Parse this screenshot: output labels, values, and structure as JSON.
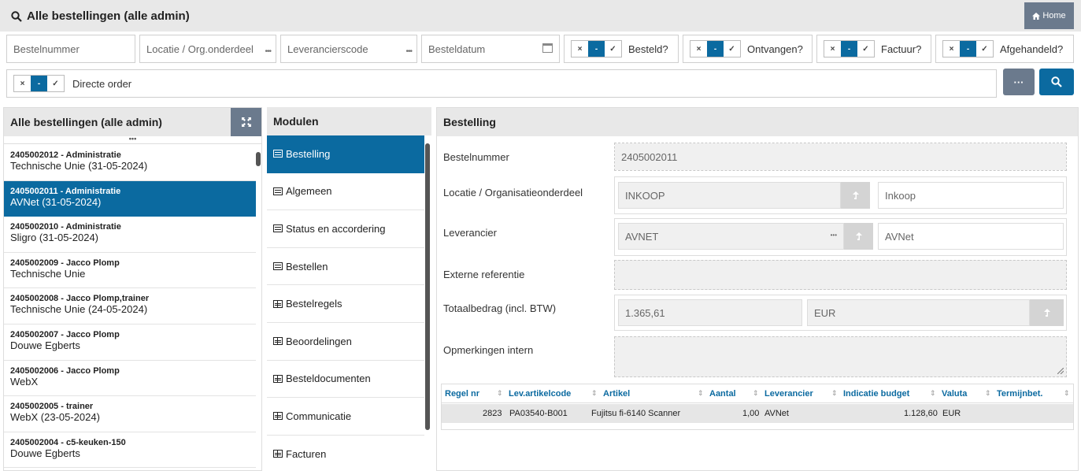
{
  "header": {
    "title": "Alle bestellingen (alle admin)",
    "home_label": "Home"
  },
  "filters": {
    "bestelnummer_placeholder": "Bestelnummer",
    "locatie_placeholder": "Locatie / Org.onderdeel",
    "leverancier_placeholder": "Leverancierscode",
    "besteldatum_placeholder": "Besteldatum",
    "toggles": [
      {
        "label": "Besteld?"
      },
      {
        "label": "Ontvangen?"
      },
      {
        "label": "Factuur?"
      },
      {
        "label": "Afgehandeld?"
      }
    ],
    "directe_order_label": "Directe order",
    "seg": {
      "no": "×",
      "mid": "-",
      "yes": "✓"
    },
    "more_label": "···"
  },
  "list_panel": {
    "title": "Alle bestellingen (alle admin)",
    "items": [
      {
        "l1": "2405002012 - Administratie",
        "l2": "Technische Unie (31-05-2024)"
      },
      {
        "l1": "2405002011 - Administratie",
        "l2": "AVNet (31-05-2024)"
      },
      {
        "l1": "2405002010 - Administratie",
        "l2": "Sligro (31-05-2024)"
      },
      {
        "l1": "2405002009 - Jacco Plomp",
        "l2": "Technische Unie"
      },
      {
        "l1": "2405002008 - Jacco Plomp,trainer",
        "l2": "Technische Unie (24-05-2024)"
      },
      {
        "l1": "2405002007 - Jacco Plomp",
        "l2": "Douwe Egberts"
      },
      {
        "l1": "2405002006 - Jacco Plomp",
        "l2": "WebX"
      },
      {
        "l1": "2405002005 - trainer",
        "l2": "WebX (23-05-2024)"
      },
      {
        "l1": "2405002004 - c5-keuken-150",
        "l2": "Douwe Egberts"
      }
    ],
    "selected_index": 1
  },
  "modules": {
    "title": "Modulen",
    "items": [
      {
        "label": "Bestelling",
        "icon": "form-icon"
      },
      {
        "label": "Algemeen",
        "icon": "form-icon"
      },
      {
        "label": "Status en accordering",
        "icon": "form-icon"
      },
      {
        "label": "Bestellen",
        "icon": "form-icon"
      },
      {
        "label": "Bestelregels",
        "icon": "table-icon"
      },
      {
        "label": "Beoordelingen",
        "icon": "table-icon"
      },
      {
        "label": "Besteldocumenten",
        "icon": "table-icon"
      },
      {
        "label": "Communicatie",
        "icon": "table-icon"
      },
      {
        "label": "Facturen",
        "icon": "table-icon"
      }
    ],
    "selected_index": 0
  },
  "detail": {
    "title": "Bestelling",
    "bestelnummer_label": "Bestelnummer",
    "bestelnummer_value": "2405002011",
    "locatie_label": "Locatie / Organisatieonderdeel",
    "locatie_code": "INKOOP",
    "locatie_name": "Inkoop",
    "leverancier_label": "Leverancier",
    "leverancier_code": "AVNET",
    "leverancier_name": "AVNet",
    "externe_label": "Externe referentie",
    "totaal_label": "Totaalbedrag (incl. BTW)",
    "totaal_value": "1.365,61",
    "totaal_valuta": "EUR",
    "opmerkingen_label": "Opmerkingen intern",
    "table": {
      "columns": [
        "Regel nr",
        "Lev.artikelcode",
        "Artikel",
        "Aantal",
        "Leverancier",
        "Indicatie budget",
        "Valuta",
        "Termijnbet."
      ],
      "row": {
        "regel_nr": "2823",
        "artikelcode": "PA03540-B001",
        "artikel": "Fujitsu fi-6140 Scanner",
        "aantal": "1,00",
        "leverancier": "AVNet",
        "budget": "1.128,60",
        "valuta": "EUR"
      }
    }
  },
  "colors": {
    "primary": "#0b6aa0",
    "secondary": "#6b7a8d",
    "header_bg": "#e8e8e8"
  }
}
